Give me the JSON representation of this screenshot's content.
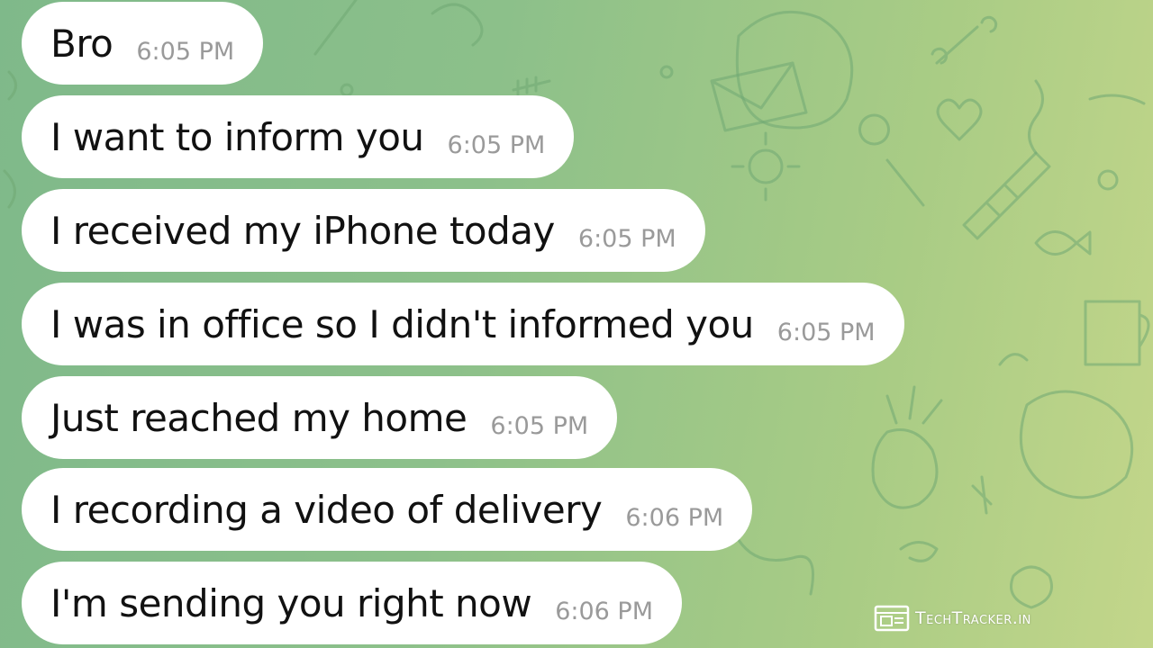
{
  "messages": [
    {
      "text": "Bro",
      "time": "6:05 PM"
    },
    {
      "text": "I want to inform you",
      "time": "6:05 PM"
    },
    {
      "text": "I received my iPhone today",
      "time": "6:05 PM"
    },
    {
      "text": "I was in office so I didn't informed you",
      "time": "6:05 PM"
    },
    {
      "text": "Just reached my home",
      "time": "6:05 PM"
    },
    {
      "text": "I recording a video of delivery",
      "time": "6:06 PM"
    },
    {
      "text": "I'm sending you right now",
      "time": "6:06 PM"
    }
  ],
  "watermark": {
    "text": "TechTracker.in",
    "icon": "browser-window-icon"
  },
  "colors": {
    "background_start": "#7fb98a",
    "background_end": "#c3d68a",
    "bubble": "#ffffff",
    "message_text": "#111111",
    "timestamp": "#9a9a9a",
    "doodle": "#6fa873"
  }
}
